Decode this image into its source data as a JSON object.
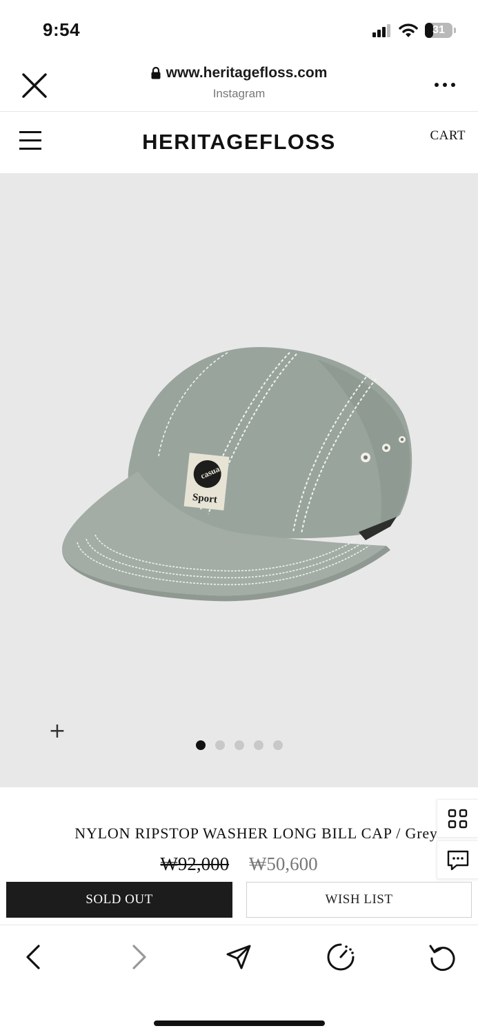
{
  "status_bar": {
    "time": "9:54",
    "battery": "31",
    "battery_level": 0.31,
    "icons": [
      "signal-icon",
      "wifi-icon",
      "battery-icon"
    ]
  },
  "browser": {
    "url": "www.heritagefloss.com",
    "source": "Instagram",
    "icons": [
      "close-icon",
      "lock-icon",
      "more-icon"
    ]
  },
  "site": {
    "logo": "HERITAGEFLOSS",
    "cart": "CART",
    "menu_icon": "hamburger-icon"
  },
  "gallery": {
    "zoom_icon": "plus-icon",
    "slide_count": 5,
    "active_slide": 1,
    "background": "#e8e8e8"
  },
  "product": {
    "name": "NYLON RIPSTOP WASHER LONG BILL CAP / Grey",
    "original_price": "₩92,000",
    "sale_price": "₩50,600",
    "patch_text_top": "casual",
    "patch_text_bottom": "Sport"
  },
  "actions": {
    "sold_out": "SOLD OUT",
    "wish_list": "WISH LIST"
  },
  "side_tools": [
    "grid-icon",
    "chat-icon"
  ],
  "toolbar": [
    "back-icon",
    "forward-icon",
    "share-icon",
    "speed-icon",
    "reload-icon"
  ]
}
